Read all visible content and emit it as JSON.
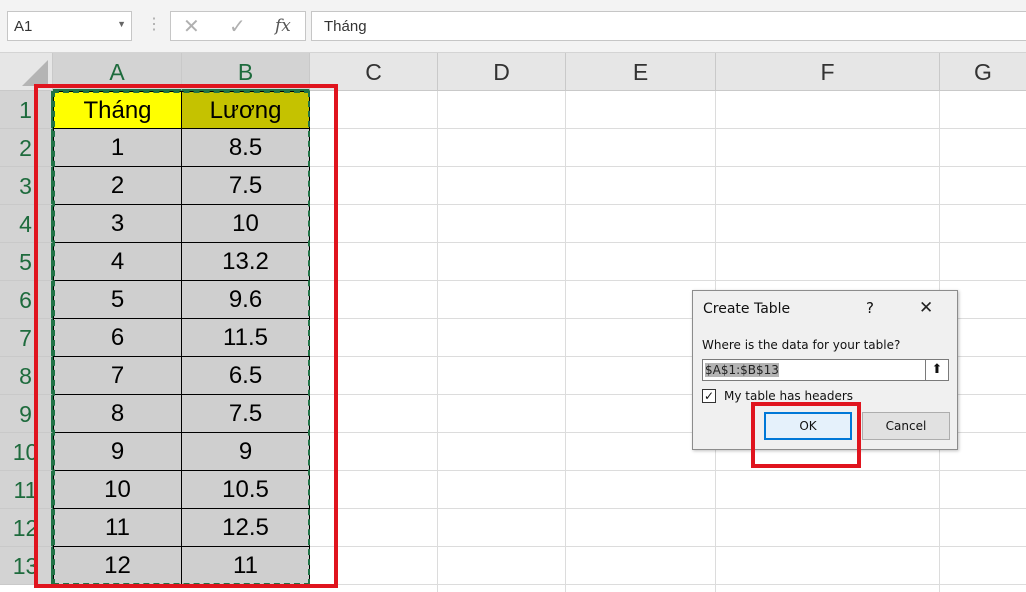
{
  "formula_bar": {
    "name_box": "A1",
    "cancel_symbol": "✕",
    "enter_symbol": "✓",
    "fx_symbol": "fx",
    "formula": "Tháng"
  },
  "columns": [
    "A",
    "B",
    "C",
    "D",
    "E",
    "F",
    "G"
  ],
  "rows": [
    "1",
    "2",
    "3",
    "4",
    "5",
    "6",
    "7",
    "8",
    "9",
    "10",
    "11",
    "12",
    "13"
  ],
  "table": {
    "headers": [
      "Tháng",
      "Lương"
    ],
    "data": [
      [
        "1",
        "8.5"
      ],
      [
        "2",
        "7.5"
      ],
      [
        "3",
        "10"
      ],
      [
        "4",
        "13.2"
      ],
      [
        "5",
        "9.6"
      ],
      [
        "6",
        "11.5"
      ],
      [
        "7",
        "6.5"
      ],
      [
        "8",
        "7.5"
      ],
      [
        "9",
        "9"
      ],
      [
        "10",
        "10.5"
      ],
      [
        "11",
        "12.5"
      ],
      [
        "12",
        "11"
      ]
    ]
  },
  "dialog": {
    "title": "Create Table",
    "help": "?",
    "close": "✕",
    "prompt": "Where is the data for your table?",
    "range": "$A$1:$B$13",
    "headers_checkbox": "My table has headers",
    "headers_checked": "✓",
    "ok": "OK",
    "cancel": "Cancel"
  },
  "colors": {
    "header_fill_a": "#ffff00",
    "header_fill_b": "#c5c200",
    "data_fill": "#cfcfcf",
    "highlight": "#e0141e",
    "excel_green": "#217346"
  }
}
